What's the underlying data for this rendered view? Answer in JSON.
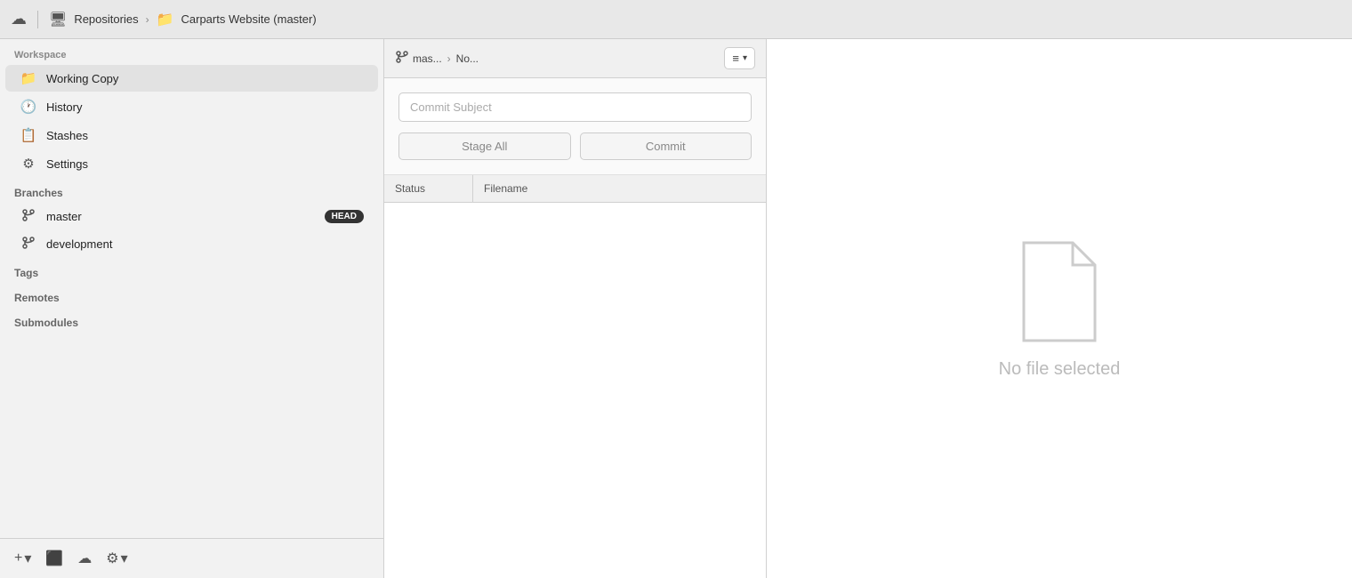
{
  "titlebar": {
    "cloud_icon": "☁",
    "divider": true,
    "repo_icon": "🖥",
    "repo_label": "Repositories",
    "chevron": "›",
    "folder_icon": "📁",
    "project_label": "Carparts Website (master)"
  },
  "sidebar": {
    "workspace_label": "Workspace",
    "items": [
      {
        "id": "working-copy",
        "icon": "📁",
        "label": "Working Copy",
        "active": true
      },
      {
        "id": "history",
        "icon": "🕐",
        "label": "History",
        "active": false
      },
      {
        "id": "stashes",
        "icon": "📋",
        "label": "Stashes",
        "active": false
      },
      {
        "id": "settings",
        "icon": "⚙",
        "label": "Settings",
        "active": false
      }
    ],
    "branches_label": "Branches",
    "branches": [
      {
        "id": "master",
        "label": "master",
        "badge": "HEAD"
      },
      {
        "id": "development",
        "label": "development",
        "badge": null
      }
    ],
    "tags_label": "Tags",
    "remotes_label": "Remotes",
    "submodules_label": "Submodules"
  },
  "middle": {
    "branch_name": "mas...",
    "chevron": "›",
    "no_branch": "No...",
    "menu_icon": "≡",
    "commit_subject_placeholder": "Commit Subject",
    "stage_all_label": "Stage All",
    "commit_label": "Commit",
    "table_headers": {
      "status": "Status",
      "filename": "Filename"
    }
  },
  "right_panel": {
    "no_file_text": "No file selected"
  },
  "footer": {
    "add_icon": "+",
    "dropdown_icon": "▾",
    "terminal_icon": "⬛",
    "cloud_icon": "☁",
    "gear_icon": "⚙"
  }
}
